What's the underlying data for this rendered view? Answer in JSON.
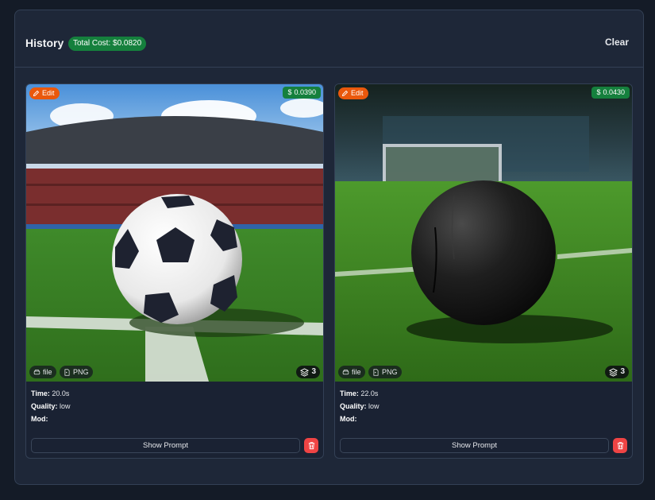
{
  "header": {
    "title": "History",
    "total_cost": "Total Cost: $0.0820",
    "clear_label": "Clear"
  },
  "cards": [
    {
      "edit_label": "Edit",
      "price": "0.0390",
      "file_label": "file",
      "format_label": "PNG",
      "layer_count": "3",
      "time_label": "Time:",
      "time_value": "20.0s",
      "quality_label": "Quality:",
      "quality_value": "low",
      "mod_label": "Mod:",
      "show_prompt_label": "Show Prompt"
    },
    {
      "edit_label": "Edit",
      "price": "0.0430",
      "file_label": "file",
      "format_label": "PNG",
      "layer_count": "3",
      "time_label": "Time:",
      "time_value": "22.0s",
      "quality_label": "Quality:",
      "quality_value": "low",
      "mod_label": "Mod:",
      "show_prompt_label": "Show Prompt"
    }
  ],
  "colors": {
    "background": "#141b27",
    "panel": "#1e2738",
    "edit_badge": "#ea580c",
    "price_badge": "#15803d",
    "delete": "#ef4444"
  }
}
